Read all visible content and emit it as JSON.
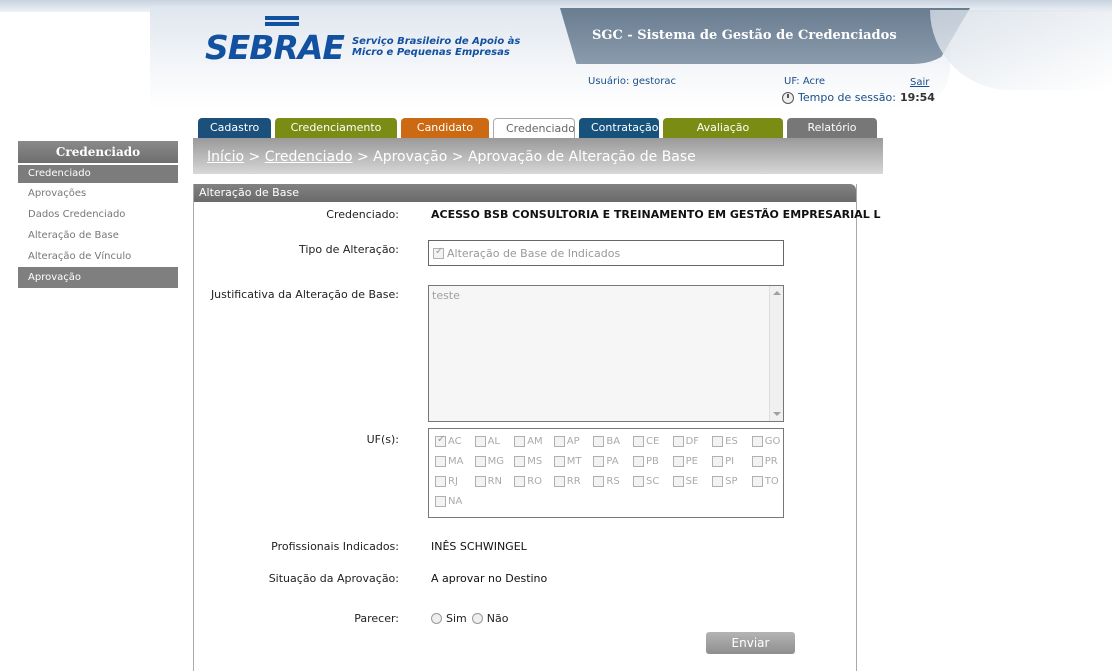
{
  "header": {
    "logo_word": "SEBRAE",
    "logo_sub_1": "Serviço Brasileiro de Apoio às",
    "logo_sub_2": "Micro e Pequenas Empresas",
    "system_title": "SGC - Sistema de Gestão de Credenciados",
    "user_text": "Usuário: gestorac",
    "uf_text": "UF: Acre",
    "logout_label": "Sair",
    "session_label": "Tempo de sessão:",
    "session_time": "19:54"
  },
  "tabs": [
    {
      "label": "Cadastro",
      "color": "#1b4f7c"
    },
    {
      "label": "Credenciamento",
      "color": "#7a8c14"
    },
    {
      "label": "Candidato",
      "color": "#cc6a14"
    },
    {
      "label": "Credenciado",
      "color": "#ffffff"
    },
    {
      "label": "Contratação",
      "color": "#17527d"
    },
    {
      "label": "Avaliação",
      "color": "#7a8c14"
    },
    {
      "label": "Relatório",
      "color": "#777777"
    }
  ],
  "breadcrumb": {
    "home": "Início",
    "sep": " > ",
    "section": "Credenciado",
    "rest": " > Aprovação > Aprovação de Alteração de Base"
  },
  "sidebar": {
    "title": "Credenciado",
    "subtitle": "Credenciado",
    "items": [
      {
        "label": "Aprovações"
      },
      {
        "label": "Dados Credenciado"
      },
      {
        "label": "Alteração de Base"
      },
      {
        "label": "Alteração de Vínculo"
      },
      {
        "label": "Aprovação"
      }
    ]
  },
  "panel": {
    "title": "Alteração de Base",
    "credenciado_label": "Credenciado:",
    "credenciado_value": "ACESSO BSB CONSULTORIA E TREINAMENTO EM GESTÃO EMPRESARIAL L",
    "tipo_label": "Tipo de Alteração:",
    "tipo_value": "Alteração de Base de Indicados",
    "justificativa_label": "Justificativa da Alteração de Base:",
    "justificativa_value": "teste",
    "uf_label": "UF(s):",
    "ufs": [
      {
        "code": "AC",
        "checked": true
      },
      {
        "code": "AL",
        "checked": false
      },
      {
        "code": "AM",
        "checked": false
      },
      {
        "code": "AP",
        "checked": false
      },
      {
        "code": "BA",
        "checked": false
      },
      {
        "code": "CE",
        "checked": false
      },
      {
        "code": "DF",
        "checked": false
      },
      {
        "code": "ES",
        "checked": false
      },
      {
        "code": "GO",
        "checked": false
      },
      {
        "code": "MA",
        "checked": false
      },
      {
        "code": "MG",
        "checked": false
      },
      {
        "code": "MS",
        "checked": false
      },
      {
        "code": "MT",
        "checked": false
      },
      {
        "code": "PA",
        "checked": false
      },
      {
        "code": "PB",
        "checked": false
      },
      {
        "code": "PE",
        "checked": false
      },
      {
        "code": "PI",
        "checked": false
      },
      {
        "code": "PR",
        "checked": false
      },
      {
        "code": "RJ",
        "checked": false
      },
      {
        "code": "RN",
        "checked": false
      },
      {
        "code": "RO",
        "checked": false
      },
      {
        "code": "RR",
        "checked": false
      },
      {
        "code": "RS",
        "checked": false
      },
      {
        "code": "SC",
        "checked": false
      },
      {
        "code": "SE",
        "checked": false
      },
      {
        "code": "SP",
        "checked": false
      },
      {
        "code": "TO",
        "checked": false
      },
      {
        "code": "NA",
        "checked": false
      }
    ],
    "profissionais_label": "Profissionais Indicados:",
    "profissionais_value": "INÊS SCHWINGEL",
    "situacao_label": "Situação da Aprovação:",
    "situacao_value": "A aprovar no Destino",
    "parecer_label": "Parecer:",
    "parecer_sim": "Sim",
    "parecer_nao": "Não",
    "submit_label": "Enviar"
  }
}
